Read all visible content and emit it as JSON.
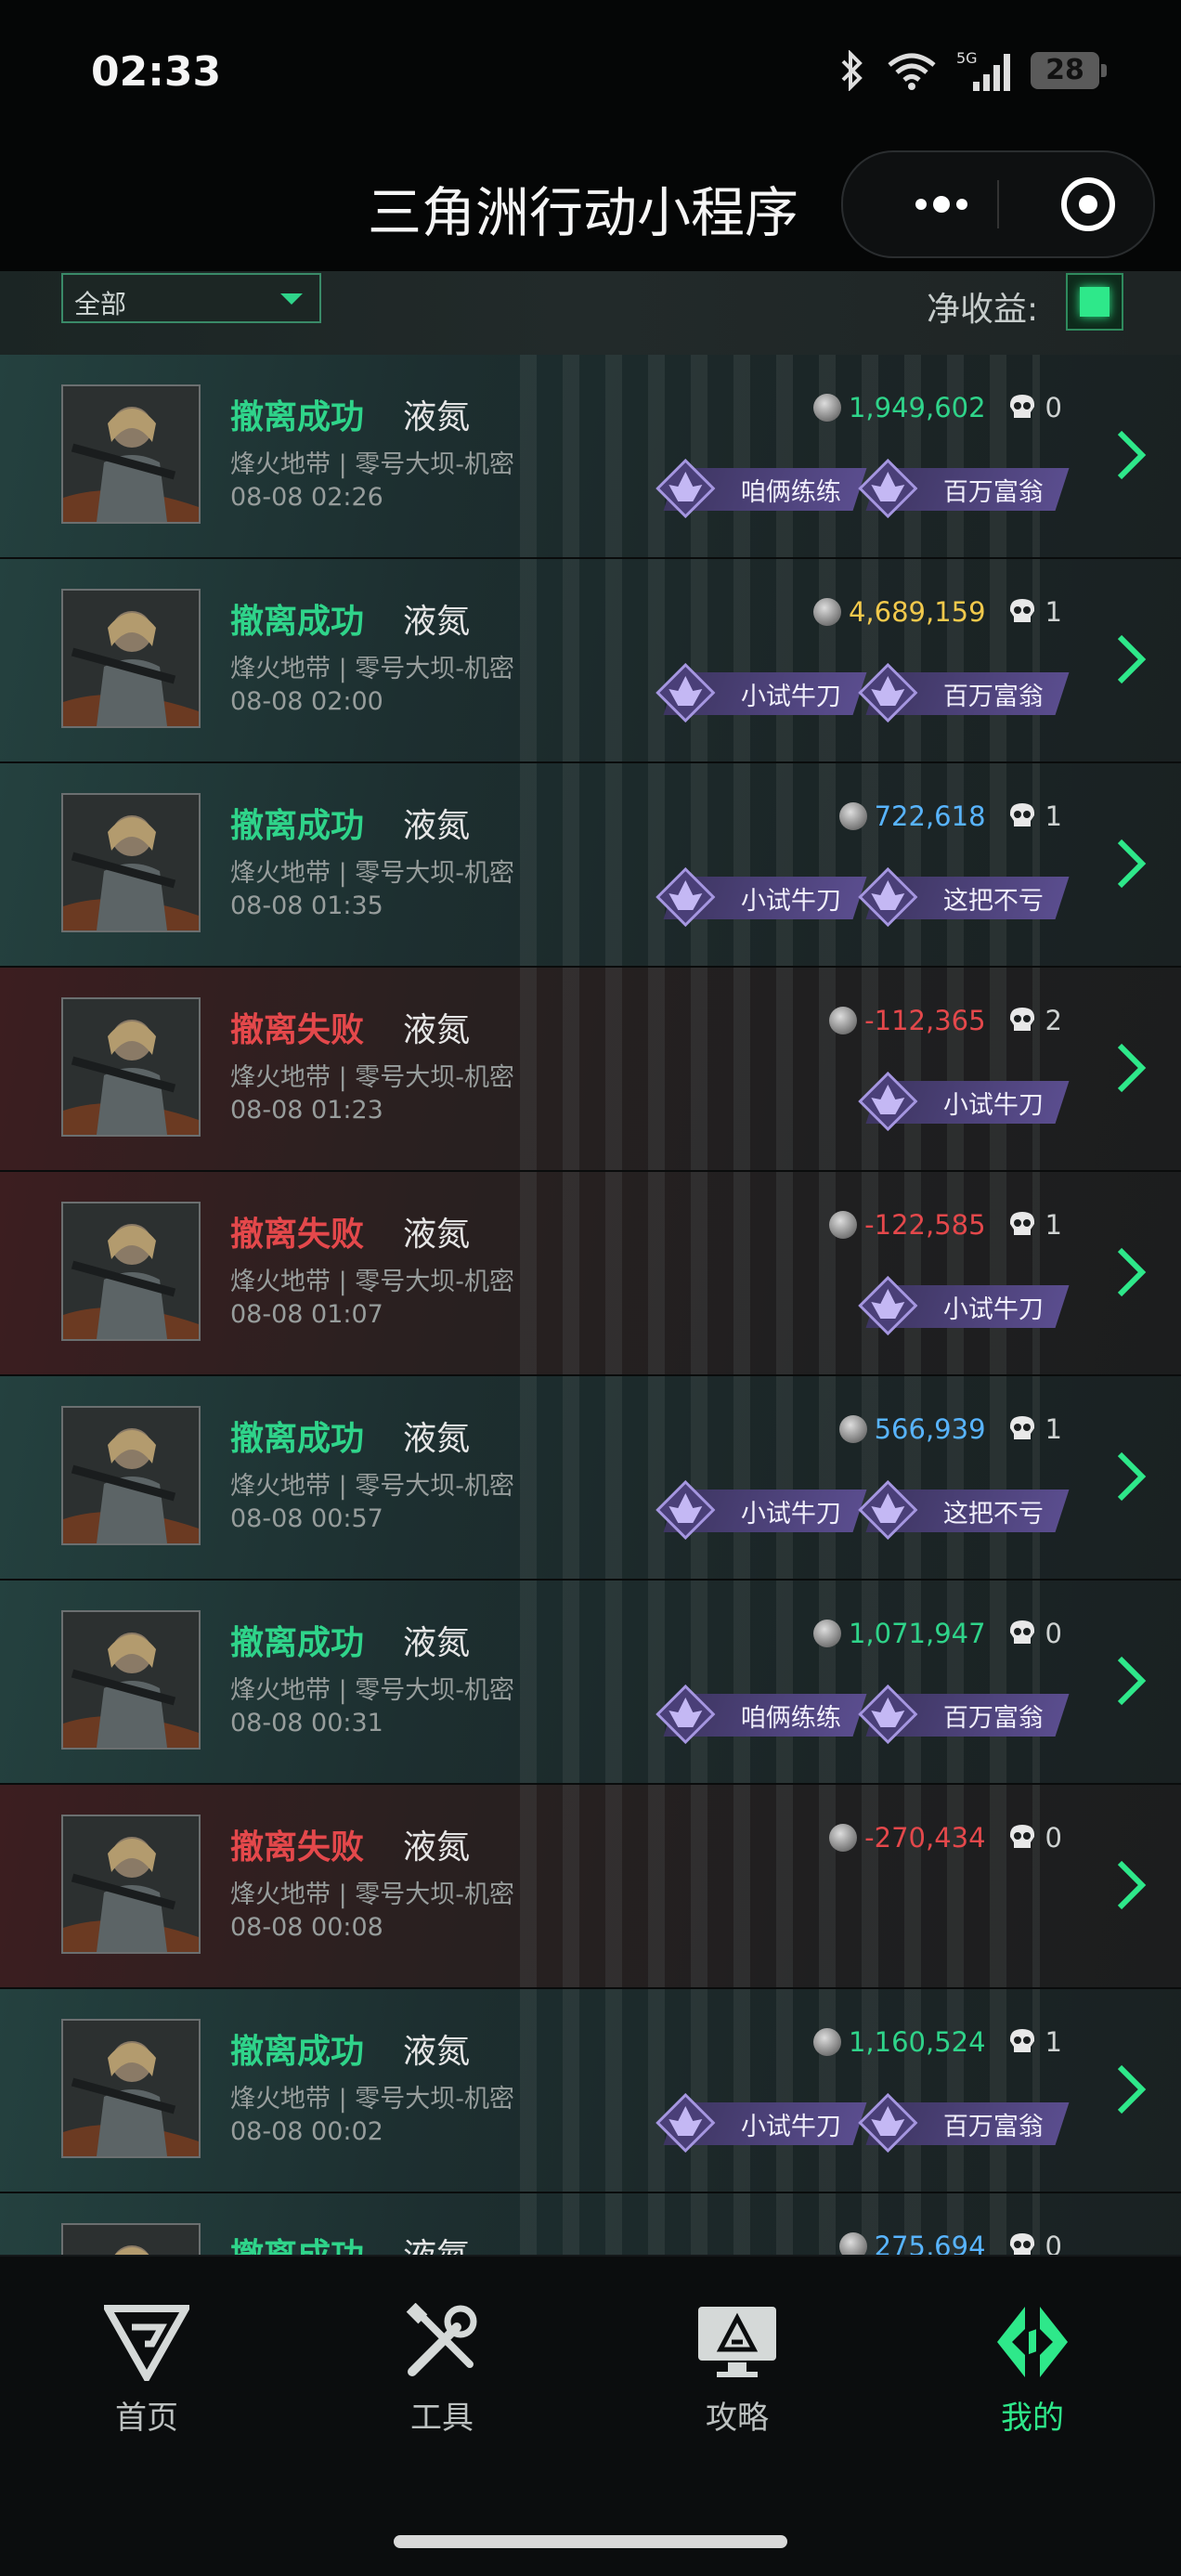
{
  "status_bar": {
    "time": "02:33",
    "battery": "28",
    "network": "5G"
  },
  "header": {
    "title": "三角洲行动小程序"
  },
  "filter": {
    "selected": "全部",
    "net_income_label": "净收益:"
  },
  "records": [
    {
      "status": "success",
      "result": "撤离成功",
      "operator": "液氮",
      "mode": "烽火地带 | 零号大坝-机密",
      "time": "08-08 02:26",
      "amount": "1,949,602",
      "amount_color": "#2fd48a",
      "kills": "0",
      "badges": [
        "咱俩练练",
        "百万富翁"
      ]
    },
    {
      "status": "success",
      "result": "撤离成功",
      "operator": "液氮",
      "mode": "烽火地带 | 零号大坝-机密",
      "time": "08-08 02:00",
      "amount": "4,689,159",
      "amount_color": "#f2c94c",
      "kills": "1",
      "badges": [
        "小试牛刀",
        "百万富翁"
      ]
    },
    {
      "status": "success",
      "result": "撤离成功",
      "operator": "液氮",
      "mode": "烽火地带 | 零号大坝-机密",
      "time": "08-08 01:35",
      "amount": "722,618",
      "amount_color": "#58b4ff",
      "kills": "1",
      "badges": [
        "小试牛刀",
        "这把不亏"
      ]
    },
    {
      "status": "fail",
      "result": "撤离失败",
      "operator": "液氮",
      "mode": "烽火地带 | 零号大坝-机密",
      "time": "08-08 01:23",
      "amount": "-112,365",
      "amount_color": "#e4484b",
      "kills": "2",
      "badges": [
        "小试牛刀"
      ]
    },
    {
      "status": "fail",
      "result": "撤离失败",
      "operator": "液氮",
      "mode": "烽火地带 | 零号大坝-机密",
      "time": "08-08 01:07",
      "amount": "-122,585",
      "amount_color": "#e4484b",
      "kills": "1",
      "badges": [
        "小试牛刀"
      ]
    },
    {
      "status": "success",
      "result": "撤离成功",
      "operator": "液氮",
      "mode": "烽火地带 | 零号大坝-机密",
      "time": "08-08 00:57",
      "amount": "566,939",
      "amount_color": "#58b4ff",
      "kills": "1",
      "badges": [
        "小试牛刀",
        "这把不亏"
      ]
    },
    {
      "status": "success",
      "result": "撤离成功",
      "operator": "液氮",
      "mode": "烽火地带 | 零号大坝-机密",
      "time": "08-08 00:31",
      "amount": "1,071,947",
      "amount_color": "#2fd48a",
      "kills": "0",
      "badges": [
        "咱俩练练",
        "百万富翁"
      ]
    },
    {
      "status": "fail",
      "result": "撤离失败",
      "operator": "液氮",
      "mode": "烽火地带 | 零号大坝-机密",
      "time": "08-08 00:08",
      "amount": "-270,434",
      "amount_color": "#e4484b",
      "kills": "0",
      "badges": []
    },
    {
      "status": "success",
      "result": "撤离成功",
      "operator": "液氮",
      "mode": "烽火地带 | 零号大坝-机密",
      "time": "08-08 00:02",
      "amount": "1,160,524",
      "amount_color": "#2fd48a",
      "kills": "1",
      "badges": [
        "小试牛刀",
        "百万富翁"
      ]
    },
    {
      "status": "success",
      "result": "撤离成功",
      "operator": "液氮",
      "mode": "",
      "time": "",
      "amount": "275,694",
      "amount_color": "#58b4ff",
      "kills": "0",
      "badges": []
    }
  ],
  "tabs": [
    {
      "label": "首页",
      "icon": "home-logo-icon",
      "active": false
    },
    {
      "label": "工具",
      "icon": "tools-icon",
      "active": false
    },
    {
      "label": "攻略",
      "icon": "guide-monitor-icon",
      "active": false
    },
    {
      "label": "我的",
      "icon": "profile-logo-icon",
      "active": true
    }
  ],
  "colors": {
    "success": "#2fd48a",
    "fail": "#e4484b",
    "accent": "#2ee88a",
    "badge": "#5a4d8e"
  }
}
